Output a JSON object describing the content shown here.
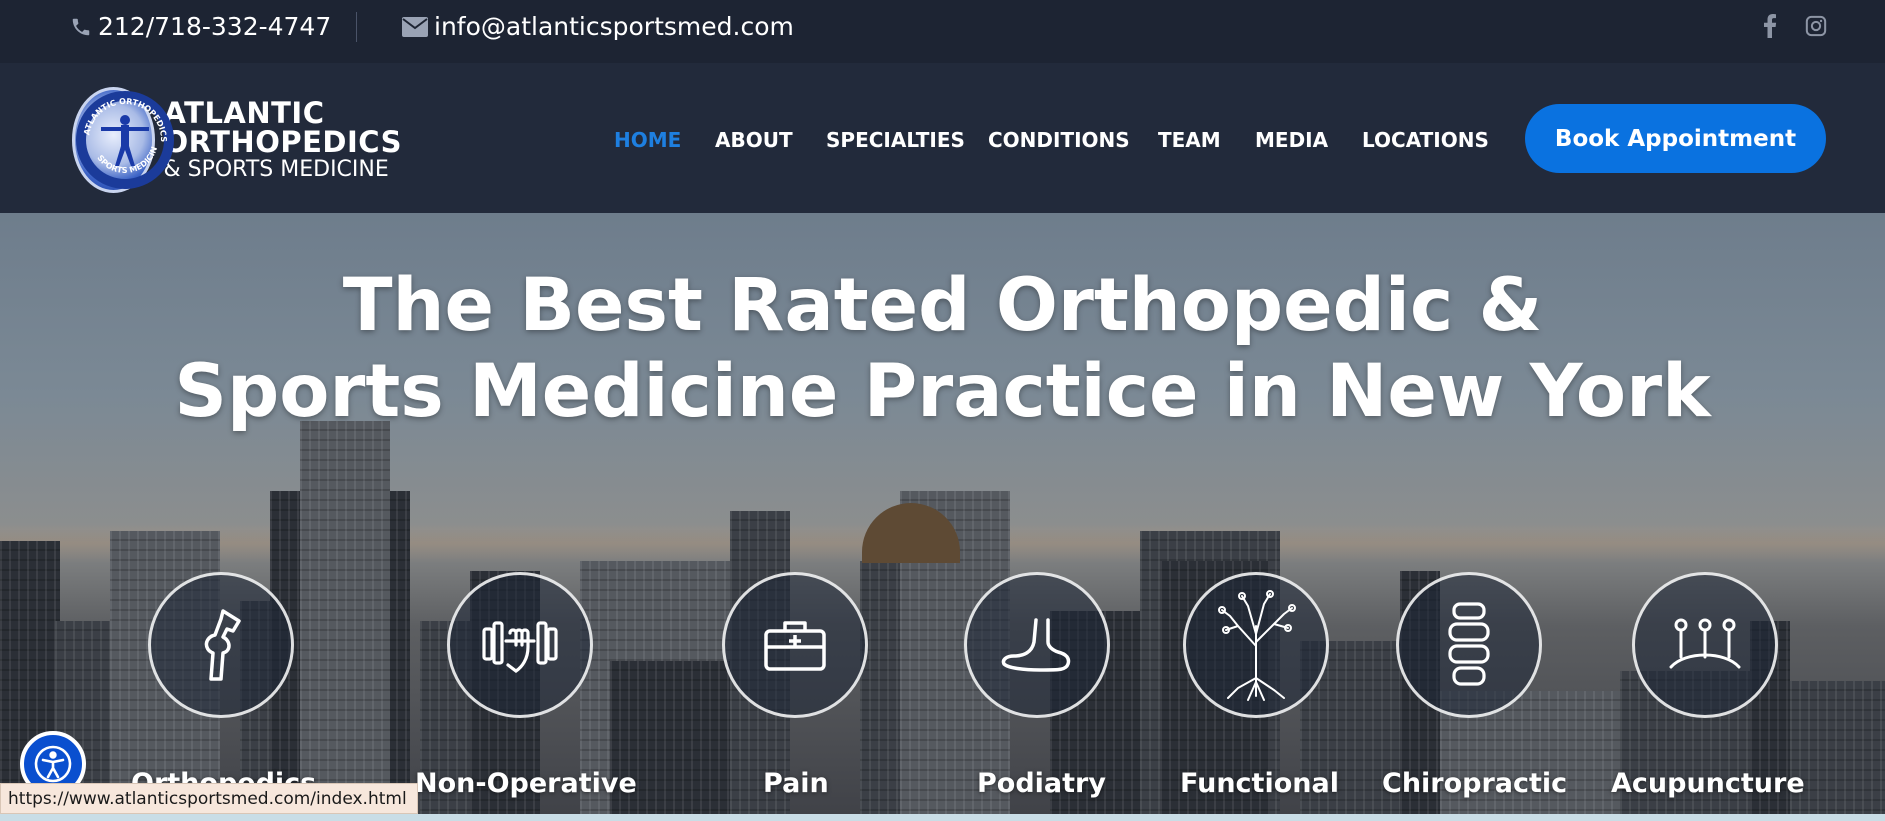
{
  "topbar": {
    "phone": "212/718-332-4747",
    "email": "info@atlanticsportsmed.com",
    "social": [
      {
        "name": "facebook-icon"
      },
      {
        "name": "instagram-icon"
      }
    ]
  },
  "logo": {
    "line1": "ATLANTIC",
    "line2": "ORTHOPEDICS",
    "line3": "& SPORTS MEDICINE",
    "badge_text_top": "ATLANTIC ORTHOPEDICS",
    "badge_text_bottom": "SPORTS MEDICINE"
  },
  "nav": {
    "items": [
      {
        "label": "HOME",
        "active": true
      },
      {
        "label": "ABOUT"
      },
      {
        "label": "SPECIALTIES"
      },
      {
        "label": "CONDITIONS"
      },
      {
        "label": "TEAM"
      },
      {
        "label": "MEDIA"
      },
      {
        "label": "LOCATIONS"
      }
    ],
    "cta": "Book Appointment"
  },
  "hero": {
    "title_line1": "The Best Rated Orthopedic &",
    "title_line2": "Sports Medicine Practice in New York"
  },
  "services": [
    {
      "label": "Orthopedics",
      "icon": "knee-joint-icon"
    },
    {
      "label": "Non-Operative",
      "icon": "dumbbell-hand-icon"
    },
    {
      "label": "Pain",
      "icon": "medical-kit-icon"
    },
    {
      "label": "Podiatry",
      "icon": "foot-icon"
    },
    {
      "label": "Functional",
      "icon": "tree-icon"
    },
    {
      "label": "Chiropractic",
      "icon": "spine-icon"
    },
    {
      "label": "Acupuncture",
      "icon": "needles-icon"
    }
  ],
  "status_url": "https://www.atlanticsportsmed.com/index.html",
  "colors": {
    "topbar": "#1d2433",
    "header": "#222a3b",
    "accent": "#0a72e0",
    "active_nav": "#1e7fe0"
  }
}
